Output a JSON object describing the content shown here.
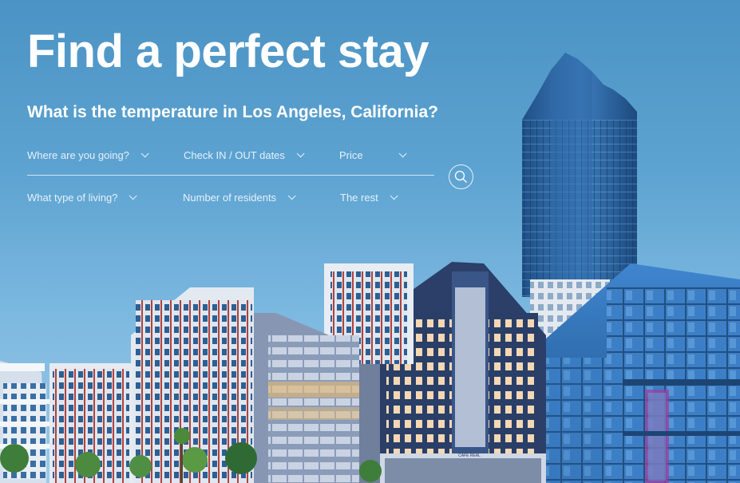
{
  "hero": {
    "title": "Find a perfect stay",
    "subtitle": "What is the temperature in Los Angeles, California?"
  },
  "filters": {
    "row1": [
      {
        "label": "Where are you going?",
        "icon": "chevron-down-icon"
      },
      {
        "label": "Check IN / OUT dates",
        "icon": "chevron-down-icon"
      },
      {
        "label": "Price",
        "icon": "chevron-down-icon"
      }
    ],
    "row2": [
      {
        "label": "What type of living?",
        "icon": "chevron-down-icon"
      },
      {
        "label": "Number of residents",
        "icon": "chevron-down-icon"
      },
      {
        "label": "The rest",
        "icon": "chevron-down-icon"
      }
    ]
  },
  "search": {
    "icon": "search-icon"
  },
  "building_sign": "CAFE REAL",
  "colors": {
    "sky_top": "#4b93c4",
    "sky_bottom": "#9ccbe9",
    "text": "#ffffff"
  }
}
